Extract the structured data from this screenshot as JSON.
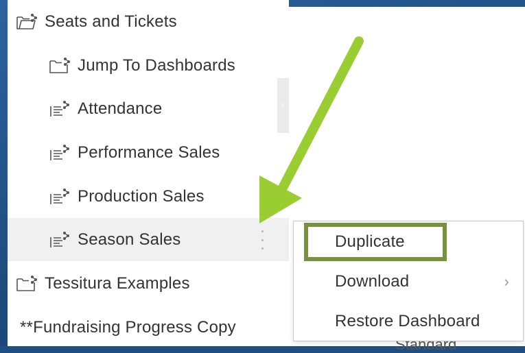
{
  "sidebar": {
    "items": [
      {
        "label": "Seats and Tickets",
        "icon": "folder-share-icon"
      },
      {
        "label": "Jump To Dashboards",
        "icon": "folder-share-icon"
      },
      {
        "label": "Attendance",
        "icon": "dashboard-share-icon"
      },
      {
        "label": "Performance Sales",
        "icon": "dashboard-share-icon"
      },
      {
        "label": "Production Sales",
        "icon": "dashboard-share-icon"
      },
      {
        "label": "Season Sales",
        "icon": "dashboard-share-icon"
      },
      {
        "label": "Tessitura Examples",
        "icon": "folder-share-icon"
      },
      {
        "label": "**Fundraising Progress Copy"
      }
    ],
    "collapse_glyph": "‹"
  },
  "context_menu": {
    "items": [
      {
        "label": "Duplicate"
      },
      {
        "label": "Download",
        "submenu_glyph": "›"
      },
      {
        "label": "Restore Dashboard"
      }
    ]
  },
  "background_text": "Standard",
  "colors": {
    "highlight": "#76923c",
    "arrow": "#9acd32",
    "frame": "#1f4e82"
  }
}
